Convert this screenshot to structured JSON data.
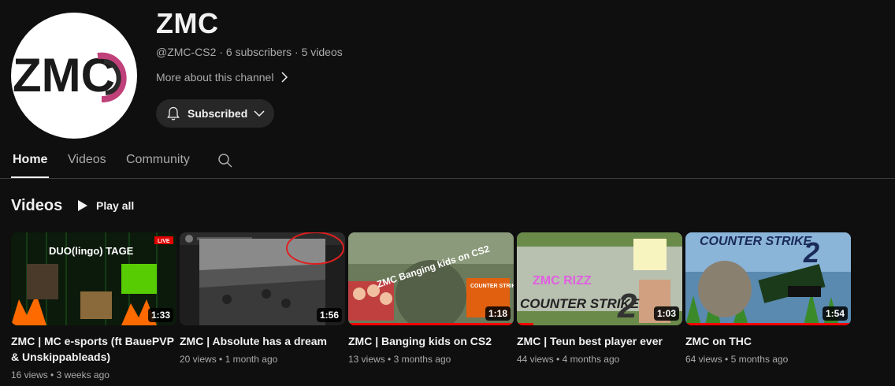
{
  "channel": {
    "name": "ZMC",
    "avatar_text": "ZMC",
    "handle": "@ZMC-CS2",
    "subscribers": "6 subscribers",
    "videos_count": "5 videos",
    "separator": "·",
    "more_about": "More about this channel",
    "subscribed_label": "Subscribed"
  },
  "tabs": [
    {
      "label": "Home",
      "active": true
    },
    {
      "label": "Videos",
      "active": false
    },
    {
      "label": "Community",
      "active": false
    }
  ],
  "section": {
    "title": "Videos",
    "play_all": "Play all"
  },
  "videos": [
    {
      "title": "ZMC | MC e-sports (ft BauePVP & Unskippableads)",
      "duration": "1:33",
      "views": "16 views",
      "age": "3 weeks ago",
      "thumb_text": "DUO(lingo) TAGE",
      "badge": "LIVE",
      "watched": 0
    },
    {
      "title": "ZMC | Absolute has a dream",
      "duration": "1:56",
      "views": "20 views",
      "age": "1 month ago",
      "watched": 0
    },
    {
      "title": "ZMC | Banging kids on CS2",
      "duration": "1:18",
      "views": "13 views",
      "age": "3 months ago",
      "thumb_text": "ZMC Banging kids on CS2",
      "watched": 1.0
    },
    {
      "title": "ZMC | Teun best player ever",
      "duration": "1:03",
      "views": "44 views",
      "age": "4 months ago",
      "thumb_text": "ZMC RIZZ",
      "thumb_text2": "COUNTER STRIKE",
      "watched": 0.1
    },
    {
      "title": "ZMC on THC",
      "duration": "1:54",
      "views": "64 views",
      "age": "5 months ago",
      "thumb_text": "COUNTER STRIKE",
      "watched": 1.0
    }
  ],
  "colors": {
    "background": "#0f0f0f",
    "text": "#f1f1f1",
    "muted": "#aaaaaa",
    "progress": "#ff0000",
    "chip": "#272727"
  }
}
